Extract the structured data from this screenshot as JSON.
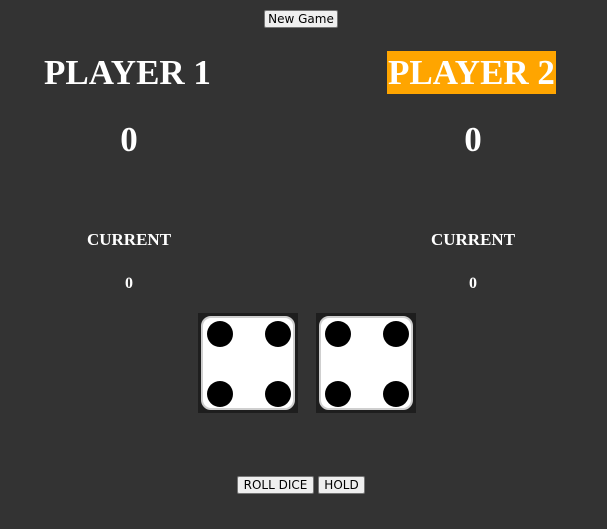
{
  "controls": {
    "new_game_label": "New Game",
    "roll_label": "ROLL DICE",
    "hold_label": "HOLD"
  },
  "players": [
    {
      "name": "PLAYER 1",
      "score": "0",
      "current_label": "CURRENT",
      "current": "0",
      "active": false
    },
    {
      "name": "PLAYER 2",
      "score": "0",
      "current_label": "CURRENT",
      "current": "0",
      "active": true
    }
  ],
  "dice": [
    {
      "value": 4
    },
    {
      "value": 4
    }
  ],
  "colors": {
    "background": "#333333",
    "active_player_highlight": "#ffa500",
    "text": "#ffffff"
  }
}
